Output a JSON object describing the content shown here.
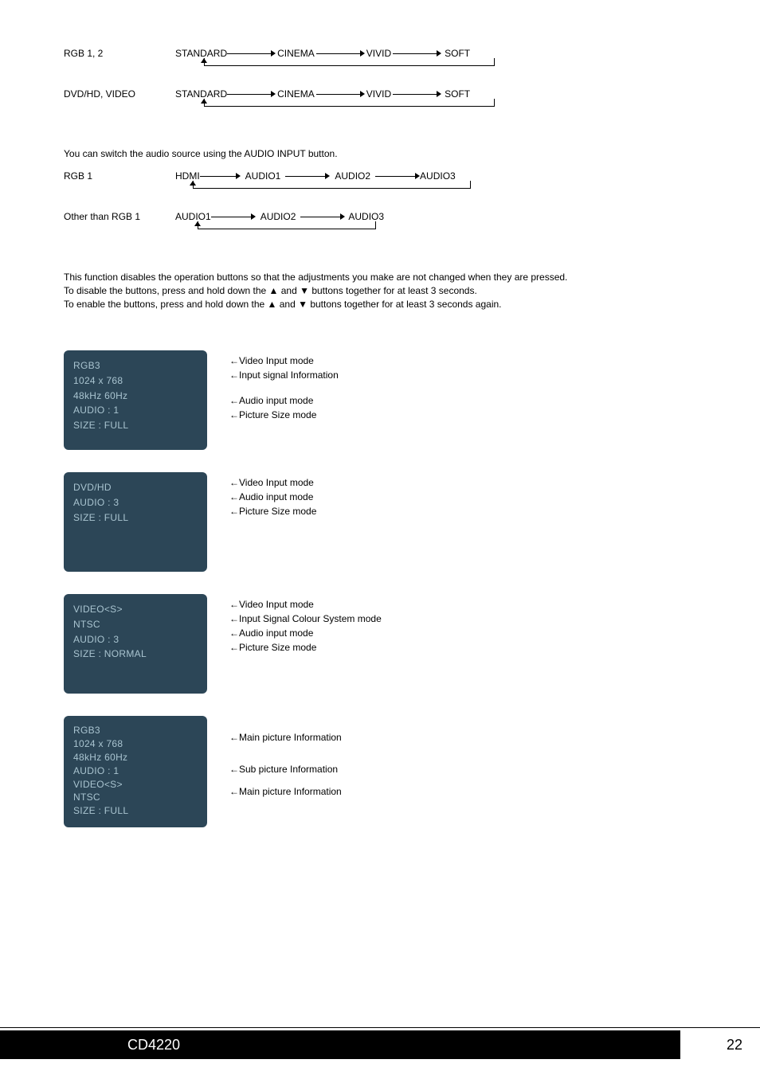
{
  "rows": {
    "rgb12": {
      "label": "RGB 1, 2",
      "steps": [
        "STANDARD",
        "CINEMA",
        "VIVID",
        "SOFT"
      ]
    },
    "dvd": {
      "label": "DVD/HD, VIDEO",
      "steps": [
        "STANDARD",
        "CINEMA",
        "VIVID",
        "SOFT"
      ]
    },
    "note1": "You can switch the audio source using the AUDIO INPUT button.",
    "rgb1": {
      "label": "RGB 1",
      "steps": [
        "HDMI",
        "AUDIO1",
        "AUDIO2",
        "AUDIO3"
      ]
    },
    "other": {
      "label": "Other than RGB 1",
      "steps": [
        "AUDIO1",
        "AUDIO2",
        "AUDIO3"
      ]
    }
  },
  "para": {
    "l1": "This function disables the operation buttons so that the adjustments you make are not changed when they are pressed.",
    "l2a": "To disable the buttons, press and hold down the ",
    "l2b": " and ",
    "l2c": " buttons together for at least 3 seconds.",
    "l3a": "To enable the buttons, press and hold down the ",
    "l3b": " and ",
    "l3c": " buttons together for at least 3 seconds again.",
    "up": "▲",
    "down": "▼"
  },
  "osd1": {
    "l1": "RGB3",
    "l2": "1024 x 768",
    "l3": "48kHz 60Hz",
    "l4": "AUDIO : 1",
    "l5": "SIZE : FULL"
  },
  "ann1": {
    "a": "←Video Input mode",
    "b": "←Input signal Information",
    "c": "←Audio input mode",
    "d": "←Picture Size mode"
  },
  "osd2": {
    "l1": "DVD/HD",
    "l2": "AUDIO : 3",
    "l3": "SIZE : FULL"
  },
  "ann2": {
    "a": "←Video Input mode",
    "b": "←Audio input mode",
    "c": "←Picture Size mode"
  },
  "osd3": {
    "l1": "VIDEO<S>",
    "l2": "NTSC",
    "l3": "AUDIO : 3",
    "l4": "SIZE : NORMAL"
  },
  "ann3": {
    "a": "←Video Input mode",
    "b": "←Input Signal Colour System mode",
    "c": "←Audio input mode",
    "d": "←Picture Size mode"
  },
  "osd4": {
    "l1": "RGB3",
    "l2": "1024 x 768",
    "l3": "48kHz 60Hz",
    "l4": "AUDIO : 1",
    "l5": "VIDEO<S>",
    "l6": "NTSC",
    "l7": "SIZE : FULL"
  },
  "ann4": {
    "a": "←Main picture Information",
    "b": "←Sub picture Information",
    "c": "←Main picture Information"
  },
  "footer": {
    "model": "CD4220",
    "page": "22"
  }
}
